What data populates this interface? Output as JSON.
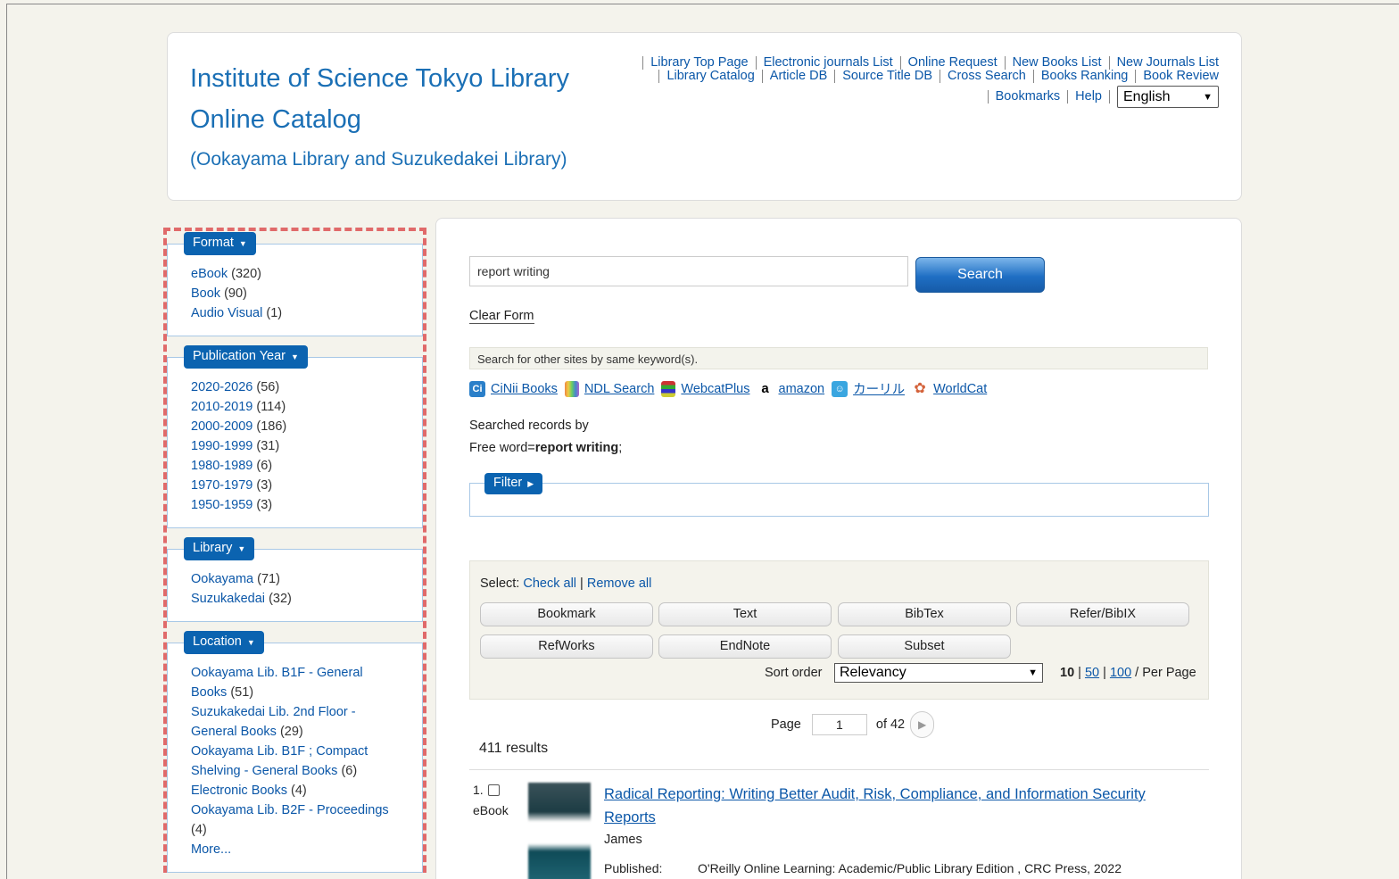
{
  "header": {
    "title": "Institute of Science Tokyo Library Online Catalog",
    "subtitle": "(Ookayama Library and Suzukedakei Library)",
    "links_row1": [
      "Library Top Page",
      "Electronic journals List",
      "Online Request",
      "New Books List",
      "New Journals List"
    ],
    "links_row2": [
      "Library Catalog",
      "Article DB",
      "Source Title DB",
      "Cross Search",
      "Books Ranking",
      "Book Review"
    ],
    "links_row3": [
      "Bookmarks",
      "Help"
    ],
    "language": "English"
  },
  "facets": [
    {
      "label": "Format",
      "items": [
        {
          "name": "eBook",
          "count": "(320)"
        },
        {
          "name": "Book",
          "count": "(90)"
        },
        {
          "name": "Audio Visual",
          "count": "(1)"
        }
      ]
    },
    {
      "label": "Publication Year",
      "items": [
        {
          "name": "2020-2026",
          "count": "(56)"
        },
        {
          "name": "2010-2019",
          "count": "(114)"
        },
        {
          "name": "2000-2009",
          "count": "(186)"
        },
        {
          "name": "1990-1999",
          "count": "(31)"
        },
        {
          "name": "1980-1989",
          "count": "(6)"
        },
        {
          "name": "1970-1979",
          "count": "(3)"
        },
        {
          "name": "1950-1959",
          "count": "(3)"
        }
      ]
    },
    {
      "label": "Library",
      "items": [
        {
          "name": "Ookayama",
          "count": "(71)"
        },
        {
          "name": "Suzukakedai",
          "count": "(32)"
        }
      ]
    },
    {
      "label": "Location",
      "items": [
        {
          "name": "Ookayama Lib. B1F - General Books",
          "count": "(51)"
        },
        {
          "name": "Suzukakedai Lib. 2nd Floor - General Books",
          "count": "(29)"
        },
        {
          "name": "Ookayama Lib. B1F ; Compact Shelving - General Books",
          "count": "(6)"
        },
        {
          "name": "Electronic Books",
          "count": "(4)"
        },
        {
          "name": "Ookayama Lib. B2F - Proceedings",
          "count": "(4)"
        }
      ],
      "more": "More..."
    }
  ],
  "search": {
    "query": "report writing",
    "button": "Search",
    "clear": "Clear Form",
    "other_sites": "Search for other sites by same keyword(s).",
    "ext_links": [
      "CiNii Books",
      "NDL Search",
      "WebcatPlus",
      "amazon",
      "カーリル",
      "WorldCat"
    ],
    "searched_by": "Searched records by",
    "free_word_label": "Free word=",
    "free_word_value": "report writing",
    "free_word_suffix": ";"
  },
  "filter": {
    "label": "Filter"
  },
  "tools": {
    "select_label": "Select:",
    "check_all": "Check all",
    "remove_all": "Remove all",
    "buttons": [
      "Bookmark",
      "Text",
      "BibTex",
      "Refer/BibIX",
      "RefWorks",
      "EndNote",
      "Subset"
    ],
    "sort_label": "Sort order",
    "sort_value": "Relevancy",
    "per_page_current": "10",
    "per_page_options": [
      "50",
      "100"
    ],
    "per_page_suffix": "/ Per Page"
  },
  "pager": {
    "label": "Page",
    "current": "1",
    "of": "of 42"
  },
  "results": {
    "count": "411 results",
    "items": [
      {
        "num": "1.",
        "type": "eBook",
        "title": "Radical Reporting: Writing Better Audit, Risk, Compliance, and Information Security Reports",
        "author": "James",
        "published_label": "Published:",
        "published": "O'Reilly Online Learning: Academic/Public Library Edition , CRC Press, 2022"
      }
    ]
  }
}
